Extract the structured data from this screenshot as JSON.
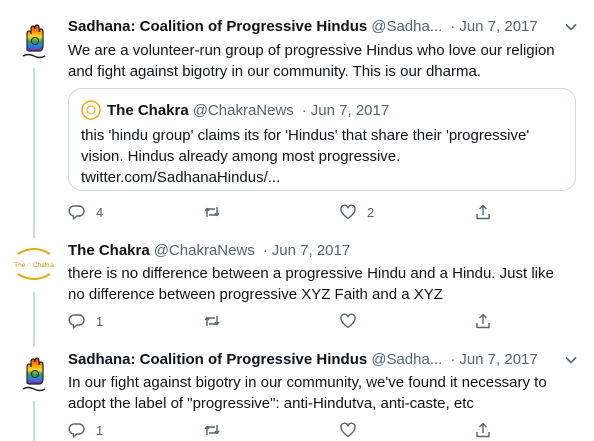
{
  "tweets": [
    {
      "name": "Sadhana: Coalition of Progressive Hindus",
      "handle": "@Sadha...",
      "date": "Jun 7, 2017",
      "text": "We are a volunteer-run group of progressive Hindus who love our religion and fight against bigotry in our community. This is our dharma.",
      "avatar": "sadhana-logo",
      "quote": {
        "name": "The Chakra",
        "handle": "@ChakraNews",
        "date": "Jun 7, 2017",
        "text": "this 'hindu group' claims its for 'Hindus' that share their 'progressive' vision. Hindus already among most progressive. twitter.com/SadhanaHindus/..."
      },
      "replies": "4",
      "retweets": "",
      "likes": "2"
    },
    {
      "name": "The Chakra",
      "handle": "@ChakraNews",
      "date": "Jun 7, 2017",
      "text": "there is no difference between a progressive Hindu and a Hindu. Just like no difference between progressive XYZ Faith and a XYZ",
      "avatar_label": "The ○ Chakra",
      "replies": "1",
      "retweets": "",
      "likes": ""
    },
    {
      "name": "Sadhana: Coalition of Progressive Hindus",
      "handle": "@Sadha...",
      "date": "Jun 7, 2017",
      "text": "In our fight against bigotry in our community, we've found it necessary to adopt the label of \"progressive\": anti-Hindutva, anti-caste, etc",
      "avatar": "sadhana-logo",
      "replies": "1",
      "retweets": "",
      "likes": ""
    }
  ],
  "colors": {
    "text": "#0f1419",
    "muted": "#536471",
    "border": "#cfd9de",
    "chakra_gold": "#e6a817"
  },
  "icons": [
    "reply-icon",
    "retweet-icon",
    "like-icon",
    "share-icon",
    "caret-down-icon"
  ]
}
